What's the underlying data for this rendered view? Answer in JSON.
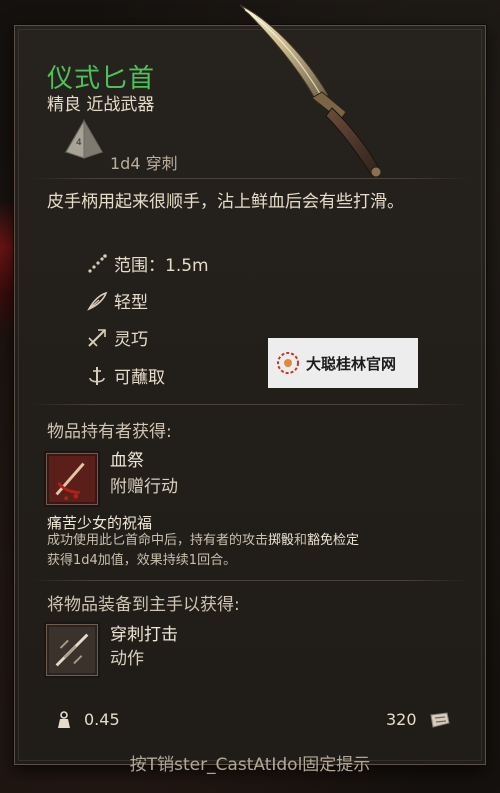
{
  "item": {
    "name": "仪式匕首",
    "rarity": "精良 近战武器",
    "damage": "1d4 穿刺",
    "description": "皮手柄用起来很顺手，沾上鲜血后会有些打滑。",
    "properties": [
      {
        "icon": "range-icon",
        "label": "范围：1.5m"
      },
      {
        "icon": "feather-icon",
        "label": "轻型"
      },
      {
        "icon": "finesse-icon",
        "label": "灵巧"
      },
      {
        "icon": "dip-icon",
        "label": "可蘸取"
      }
    ]
  },
  "holder_section": {
    "title": "物品持有者获得:",
    "ability_name": "血祭",
    "ability_type": "附赠行动",
    "blessing_title": "痛苦少女的祝福",
    "blessing_desc_1": "成功使用此匕首命中后，持有者的攻击",
    "blessing_hl_1": "掷骰",
    "blessing_desc_2": "和",
    "blessing_hl_2": "豁免检定",
    "blessing_desc_3": "获得1d4加值，效果持续1回合。"
  },
  "mainhand_section": {
    "title": "将物品装备到主手以获得:",
    "ability_name": "穿刺打击",
    "ability_type": "动作"
  },
  "footer": {
    "weight": "0.45",
    "value": "320",
    "hint": "按T销ster_CastAtIdol固定提示"
  },
  "watermark": {
    "text": "大聪桂林官网"
  },
  "colors": {
    "name": "#4ec05a",
    "gold": "#c9a24a"
  }
}
